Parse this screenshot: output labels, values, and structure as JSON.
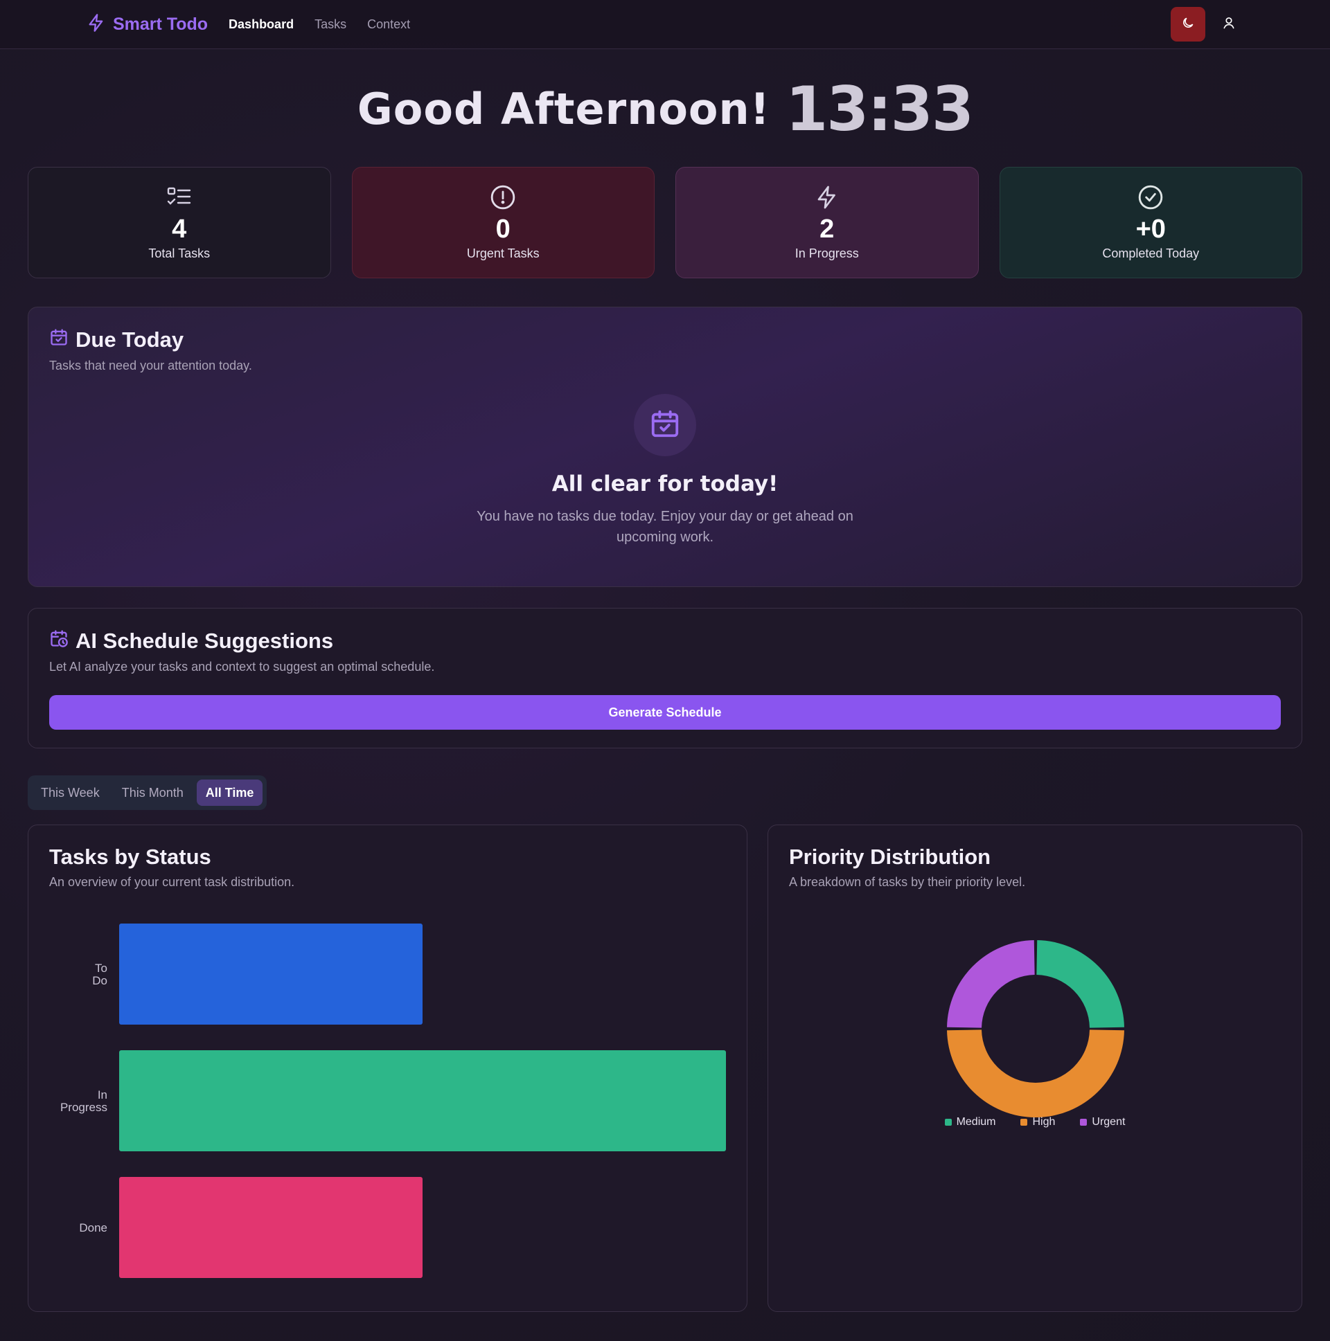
{
  "nav": {
    "brand": "Smart Todo",
    "links": [
      {
        "label": "Dashboard",
        "active": true
      },
      {
        "label": "Tasks",
        "active": false
      },
      {
        "label": "Context",
        "active": false
      }
    ],
    "theme_icon": "moon-icon",
    "user_icon": "user-icon"
  },
  "greeting": {
    "text": "Good Afternoon!",
    "time": "13:33"
  },
  "stats": [
    {
      "value": "4",
      "label": "Total Tasks",
      "icon": "list-checks-icon"
    },
    {
      "value": "0",
      "label": "Urgent Tasks",
      "icon": "alert-circle-icon"
    },
    {
      "value": "2",
      "label": "In Progress",
      "icon": "zap-icon"
    },
    {
      "value": "+0",
      "label": "Completed Today",
      "icon": "check-circle-icon"
    }
  ],
  "due_today": {
    "title": "Due Today",
    "subtitle": "Tasks that need your attention today.",
    "empty_title": "All clear for today!",
    "empty_text": "You have no tasks due today. Enjoy your day or get ahead on upcoming work."
  },
  "ai_schedule": {
    "title": "AI Schedule Suggestions",
    "subtitle": "Let AI analyze your tasks and context to suggest an optimal schedule.",
    "button": "Generate Schedule"
  },
  "range_tabs": [
    {
      "label": "This Week",
      "active": false
    },
    {
      "label": "This Month",
      "active": false
    },
    {
      "label": "All Time",
      "active": true
    }
  ],
  "status_chart": {
    "title": "Tasks by Status",
    "subtitle": "An overview of your current task distribution."
  },
  "priority_chart": {
    "title": "Priority Distribution",
    "subtitle": "A breakdown of tasks by their priority level."
  },
  "chart_data": [
    {
      "type": "bar",
      "orientation": "horizontal",
      "categories": [
        "To Do",
        "In Progress",
        "Done"
      ],
      "values": [
        1,
        2,
        1
      ],
      "colors": [
        "#2563db",
        "#2db789",
        "#e23670"
      ]
    },
    {
      "type": "pie",
      "donut": true,
      "labels": [
        "Medium",
        "High",
        "Urgent"
      ],
      "values": [
        1,
        2,
        1
      ],
      "colors": [
        "#2db789",
        "#e88c30",
        "#af57db"
      ],
      "legend": "bottom"
    }
  ],
  "colors": {
    "accent": "#8a55ef",
    "background": "#1a1522"
  }
}
